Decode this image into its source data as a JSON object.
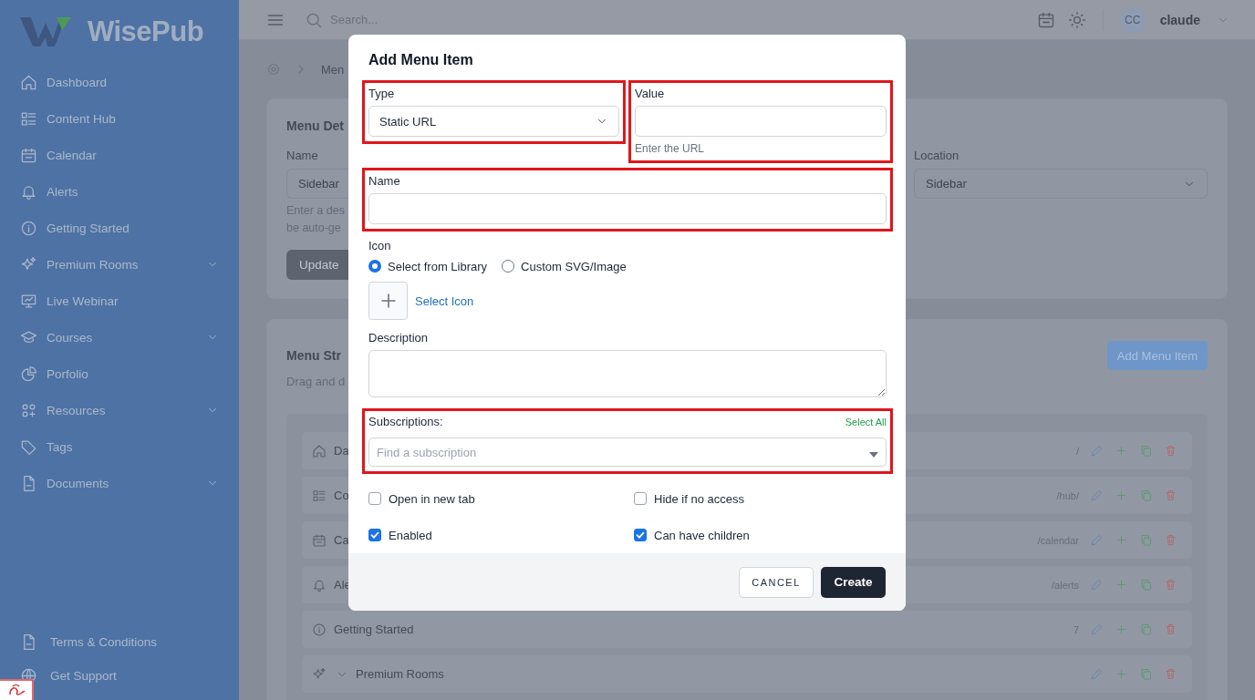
{
  "sidebar": {
    "brand": "WisePub",
    "items": [
      {
        "label": "Dashboard",
        "expandable": false
      },
      {
        "label": "Content Hub",
        "expandable": false
      },
      {
        "label": "Calendar",
        "expandable": false
      },
      {
        "label": "Alerts",
        "expandable": false
      },
      {
        "label": "Getting Started",
        "expandable": false
      },
      {
        "label": "Premium Rooms",
        "expandable": true
      },
      {
        "label": "Live Webinar",
        "expandable": false
      },
      {
        "label": "Courses",
        "expandable": true
      },
      {
        "label": "Porfolio",
        "expandable": false
      },
      {
        "label": "Resources",
        "expandable": true
      },
      {
        "label": "Tags",
        "expandable": false
      },
      {
        "label": "Documents",
        "expandable": true
      }
    ],
    "footer_items": [
      {
        "label": "Terms & Conditions"
      },
      {
        "label": "Get Support"
      }
    ]
  },
  "topbar": {
    "search_placeholder": "Search...",
    "avatar_initials": "CC",
    "user": "claude"
  },
  "breadcrumb": {
    "current": "Men"
  },
  "details_card": {
    "title": "Menu Det",
    "name_label": "Name",
    "name_value": "Sidebar",
    "help_lines": [
      "Enter a des",
      "be auto-ge"
    ],
    "button": "Update",
    "location_label": "Location",
    "location_value": "Sidebar"
  },
  "structure_card": {
    "title": "Menu Str",
    "subtitle": "Drag and d",
    "add_button": "Add Menu Item",
    "rows": [
      {
        "label": "Da",
        "url": "/",
        "expandable": false
      },
      {
        "label": "Co",
        "url": "/hub/",
        "expandable": false
      },
      {
        "label": "Ca",
        "url": "/calendar",
        "expandable": false
      },
      {
        "label": "Ale",
        "url": "/alerts",
        "expandable": false
      },
      {
        "label": "Getting Started",
        "url": "7",
        "expandable": false
      },
      {
        "label": "Premium Rooms",
        "expandable": true
      }
    ]
  },
  "modal": {
    "title": "Add Menu Item",
    "type_field": {
      "label": "Type",
      "value": "Static URL",
      "highlighted": true
    },
    "value_field": {
      "label": "Value",
      "help": "Enter the URL",
      "highlighted": true
    },
    "name_field": {
      "label": "Name",
      "highlighted": true
    },
    "icon_field": {
      "label": "Icon",
      "options": [
        {
          "label": "Select from Library",
          "selected": true
        },
        {
          "label": "Custom SVG/Image",
          "selected": false
        }
      ],
      "picker_label": "Select Icon"
    },
    "description_field": {
      "label": "Description"
    },
    "subscriptions_field": {
      "label": "Subscriptions:",
      "action": "Select All",
      "placeholder": "Find a subscription",
      "highlighted": true
    },
    "checkboxes": [
      {
        "label": "Open in new tab",
        "checked": false
      },
      {
        "label": "Hide if no access",
        "checked": false
      },
      {
        "label": "Enabled",
        "checked": true
      },
      {
        "label": "Can have children",
        "checked": true
      }
    ],
    "buttons": [
      {
        "label": "CANCEL",
        "kind": "secondary"
      },
      {
        "label": "Create",
        "kind": "primary"
      }
    ]
  }
}
